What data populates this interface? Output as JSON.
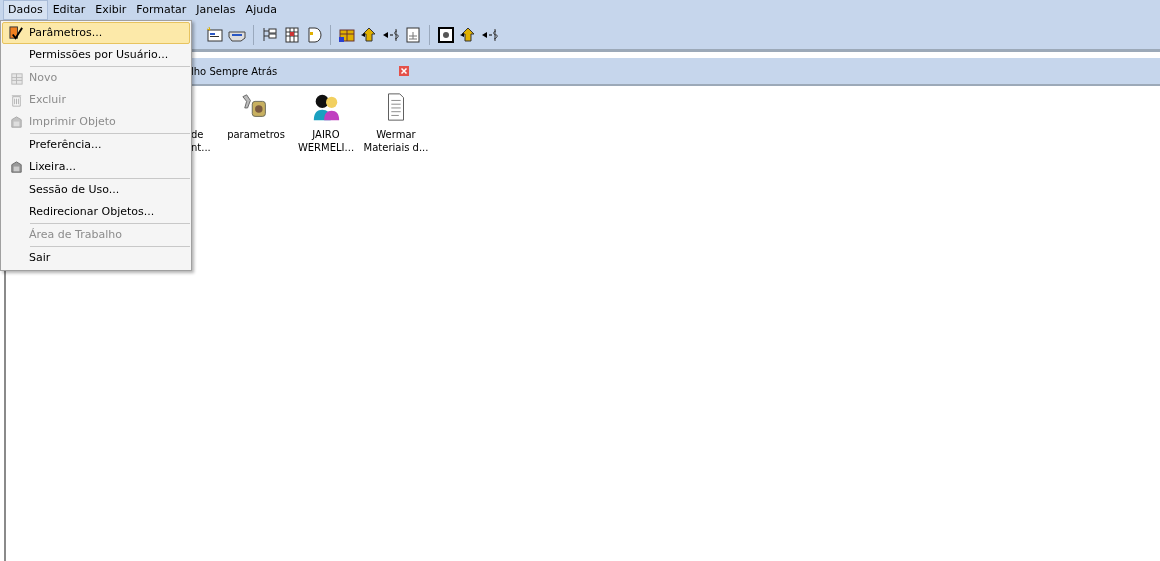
{
  "menubar": [
    {
      "label": "Dados",
      "selected": true
    },
    {
      "label": "Editar",
      "selected": false
    },
    {
      "label": "Exibir",
      "selected": false
    },
    {
      "label": "Formatar",
      "selected": false
    },
    {
      "label": "Janelas",
      "selected": false
    },
    {
      "label": "Ajuda",
      "selected": false
    }
  ],
  "dropdown": [
    {
      "kind": "item",
      "label": "Parâmetros...",
      "selected": true,
      "disabled": false
    },
    {
      "kind": "item",
      "label": "Permissões por Usuário...",
      "selected": false,
      "disabled": false
    },
    {
      "kind": "separator"
    },
    {
      "kind": "item",
      "label": "Novo",
      "selected": false,
      "disabled": true
    },
    {
      "kind": "item",
      "label": "Excluir",
      "selected": false,
      "disabled": true
    },
    {
      "kind": "item",
      "label": "Imprimir Objeto",
      "selected": false,
      "disabled": true
    },
    {
      "kind": "separator"
    },
    {
      "kind": "item",
      "label": "Preferência...",
      "selected": false,
      "disabled": false
    },
    {
      "kind": "item",
      "label": "Lixeira...",
      "selected": false,
      "disabled": false
    },
    {
      "kind": "separator"
    },
    {
      "kind": "item",
      "label": "Sessão de Uso...",
      "selected": false,
      "disabled": false
    },
    {
      "kind": "item",
      "label": "Redirecionar Objetos...",
      "selected": false,
      "disabled": false
    },
    {
      "kind": "separator"
    },
    {
      "kind": "item",
      "label": "Área de Trabalho",
      "selected": false,
      "disabled": true
    },
    {
      "kind": "separator"
    },
    {
      "kind": "item",
      "label": "Sair",
      "selected": false,
      "disabled": false
    }
  ],
  "child_window": {
    "title": "lho Sempre Atrás"
  },
  "desktop_icons": [
    {
      "kind": "hidden",
      "label": [
        "de",
        "nt..."
      ]
    },
    {
      "kind": "tools",
      "label": [
        "parametros"
      ]
    },
    {
      "kind": "people",
      "label": [
        "JAIRO",
        "WERMELI..."
      ]
    },
    {
      "kind": "document",
      "label": [
        "Wermar",
        "Materiais d..."
      ]
    }
  ]
}
